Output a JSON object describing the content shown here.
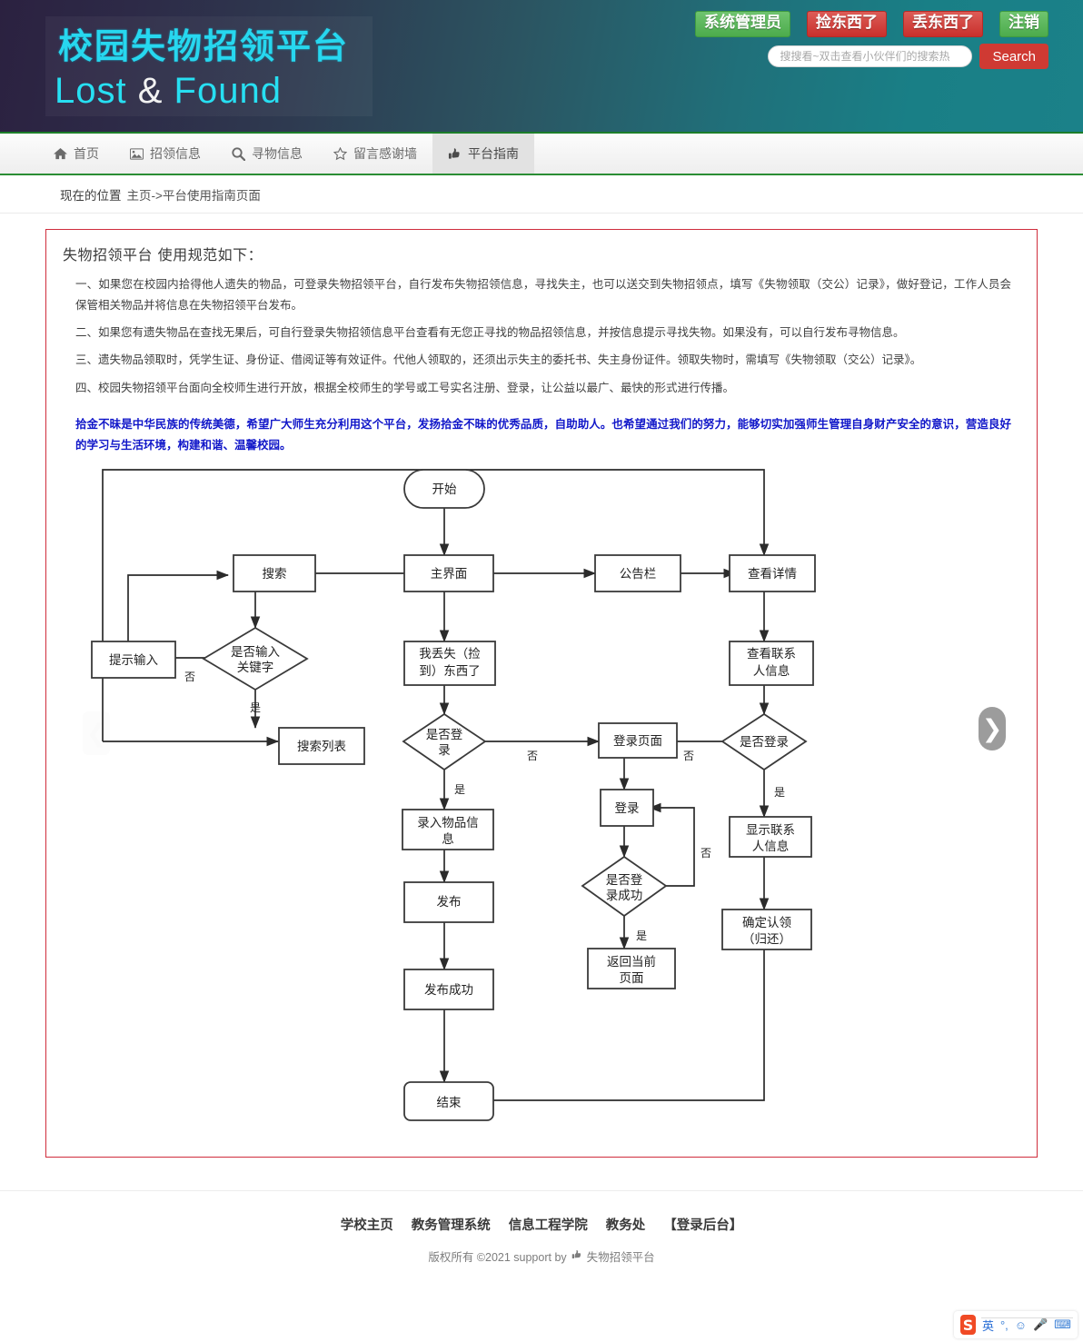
{
  "header": {
    "logo_cn": "校园失物招领平台",
    "logo_en_1": "Lost ",
    "logo_en_amp": "&",
    "logo_en_2": " Found",
    "links": [
      {
        "label": "系统管理员",
        "style": "green",
        "name": "admin-link"
      },
      {
        "label": "捡东西了",
        "style": "red",
        "name": "found-item-link"
      },
      {
        "label": "丢东西了",
        "style": "red",
        "name": "lost-item-link"
      },
      {
        "label": "注销",
        "style": "green",
        "name": "logout-link"
      }
    ],
    "search": {
      "placeholder": "搜搜看~双击查看小伙伴们的搜索热",
      "value": "",
      "button_label": "Search"
    },
    "colors": {
      "green": "#4cab4c",
      "red": "#c9302c",
      "search_button": "#cf3a33",
      "logo_cyan": "#27d7ef"
    }
  },
  "nav": {
    "items": [
      {
        "label": "首页",
        "icon": "home-icon",
        "active": false
      },
      {
        "label": "招领信息",
        "icon": "image-icon",
        "active": false
      },
      {
        "label": "寻物信息",
        "icon": "search-icon",
        "active": false
      },
      {
        "label": "留言感谢墙",
        "icon": "star-icon",
        "active": false
      },
      {
        "label": "平台指南",
        "icon": "thumbs-up-icon",
        "active": true
      }
    ]
  },
  "breadcrumb": {
    "label": "现在的位置",
    "path": "主页->平台使用指南页面"
  },
  "panel": {
    "title": "失物招领平台 使用规范如下：",
    "border_color": "#cf2d3c",
    "paragraphs": [
      "一、如果您在校园内拾得他人遗失的物品，可登录失物招领平台，自行发布失物招领信息，寻找失主，也可以送交到失物招领点，填写《失物领取（交公）记录》，做好登记，工作人员会保管相关物品并将信息在失物招领平台发布。",
      "二、如果您有遗失物品在查找无果后，可自行登录失物招领信息平台查看有无您正寻找的物品招领信息，并按信息提示寻找失物。如果没有，可以自行发布寻物信息。",
      "三、遗失物品领取时，凭学生证、身份证、借阅证等有效证件。代他人领取的，还须出示失主的委托书、失主身份证件。领取失物时，需填写《失物领取（交公）记录》。",
      "四、校园失物招领平台面向全校师生进行开放，根据全校师生的学号或工号实名注册、登录，让公益以最广、最快的形式进行传播。"
    ],
    "highlight": "拾金不昧是中华民族的传统美德，希望广大师生充分利用这个平台，发扬拾金不昧的优秀品质，自助助人。也希望通过我们的努力，能够切实加强师生管理自身财产安全的意识，营造良好的学习与生活环境，构建和谐、温馨校园。",
    "highlight_color": "#1117c9"
  },
  "carousel": {
    "prev": "❮",
    "next": "❯"
  },
  "flowchart": {
    "type": "flowchart",
    "nodes": {
      "start": "开始",
      "main": "主界面",
      "search": "搜索",
      "board": "公告栏",
      "detail": "查看详情",
      "prompt_input": "提示输入",
      "has_keyword": "是否输入关键字",
      "lost_found": "我丢失（捡到）东西了",
      "view_contact": "查看联系人信息",
      "search_list": "搜索列表",
      "is_login_a": "是否登录",
      "login_page": "登录页面",
      "is_login_b": "是否登录",
      "login": "登录",
      "enter_item": "录入物品信息",
      "login_ok": "是否登录成功",
      "show_contact": "显示联系人信息",
      "publish": "发布",
      "back_page": "返回当前页面",
      "confirm_claim": "确定认领（归还）",
      "publish_ok": "发布成功",
      "end": "结束"
    },
    "labels": {
      "yes": "是",
      "no": "否"
    }
  },
  "footer": {
    "links": [
      "学校主页",
      "教务管理系统",
      "信息工程学院",
      "教务处",
      "【登录后台】"
    ],
    "copyright_pre": "版权所有 ©2021 support by",
    "copyright_site": "失物招领平台"
  },
  "ime": {
    "logo": "S",
    "mode": "英",
    "punct": "°,",
    "emoji": "☺",
    "mic": "🎤",
    "keyboard": "⌨"
  }
}
